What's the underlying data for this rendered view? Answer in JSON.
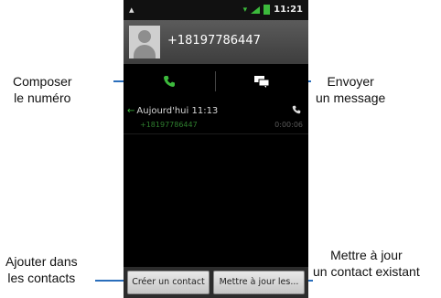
{
  "status_bar": {
    "time": "11:21"
  },
  "contact": {
    "phone_number": "+18197786447"
  },
  "history": {
    "title": "Aujourd'hui 11:13",
    "number": "+18197786447",
    "duration": "0:00:06"
  },
  "buttons": {
    "create_contact": "Créer un contact",
    "update_contact": "Mettre à jour les..."
  },
  "callouts": {
    "call": [
      "Composer",
      "le numéro"
    ],
    "message": [
      "Envoyer",
      "un message"
    ],
    "add_contact": [
      "Ajouter dans",
      "les contacts"
    ],
    "update_contact": [
      "Mettre à jour",
      "un contact existant"
    ]
  },
  "colors": {
    "accent_green": "#3cba3c",
    "leader_blue": "#2a6ebb"
  },
  "icons": [
    "call-icon",
    "message-icon",
    "avatar-icon",
    "incoming-call-icon",
    "phone-icon"
  ]
}
